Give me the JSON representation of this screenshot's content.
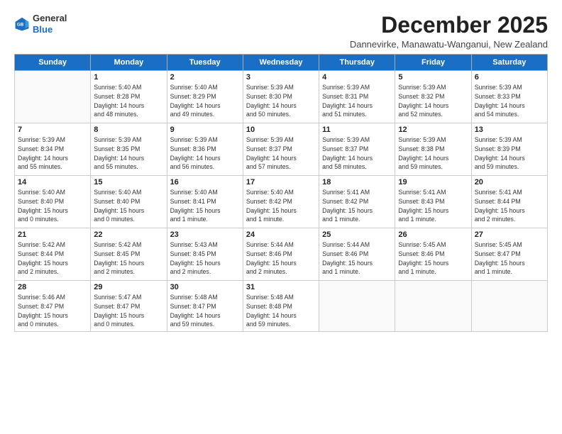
{
  "logo": {
    "line1": "General",
    "line2": "Blue"
  },
  "title": "December 2025",
  "location": "Dannevirke, Manawatu-Wanganui, New Zealand",
  "days_of_week": [
    "Sunday",
    "Monday",
    "Tuesday",
    "Wednesday",
    "Thursday",
    "Friday",
    "Saturday"
  ],
  "weeks": [
    [
      {
        "day": "",
        "info": ""
      },
      {
        "day": "1",
        "info": "Sunrise: 5:40 AM\nSunset: 8:28 PM\nDaylight: 14 hours\nand 48 minutes."
      },
      {
        "day": "2",
        "info": "Sunrise: 5:40 AM\nSunset: 8:29 PM\nDaylight: 14 hours\nand 49 minutes."
      },
      {
        "day": "3",
        "info": "Sunrise: 5:39 AM\nSunset: 8:30 PM\nDaylight: 14 hours\nand 50 minutes."
      },
      {
        "day": "4",
        "info": "Sunrise: 5:39 AM\nSunset: 8:31 PM\nDaylight: 14 hours\nand 51 minutes."
      },
      {
        "day": "5",
        "info": "Sunrise: 5:39 AM\nSunset: 8:32 PM\nDaylight: 14 hours\nand 52 minutes."
      },
      {
        "day": "6",
        "info": "Sunrise: 5:39 AM\nSunset: 8:33 PM\nDaylight: 14 hours\nand 54 minutes."
      }
    ],
    [
      {
        "day": "7",
        "info": "Sunrise: 5:39 AM\nSunset: 8:34 PM\nDaylight: 14 hours\nand 55 minutes."
      },
      {
        "day": "8",
        "info": "Sunrise: 5:39 AM\nSunset: 8:35 PM\nDaylight: 14 hours\nand 55 minutes."
      },
      {
        "day": "9",
        "info": "Sunrise: 5:39 AM\nSunset: 8:36 PM\nDaylight: 14 hours\nand 56 minutes."
      },
      {
        "day": "10",
        "info": "Sunrise: 5:39 AM\nSunset: 8:37 PM\nDaylight: 14 hours\nand 57 minutes."
      },
      {
        "day": "11",
        "info": "Sunrise: 5:39 AM\nSunset: 8:37 PM\nDaylight: 14 hours\nand 58 minutes."
      },
      {
        "day": "12",
        "info": "Sunrise: 5:39 AM\nSunset: 8:38 PM\nDaylight: 14 hours\nand 59 minutes."
      },
      {
        "day": "13",
        "info": "Sunrise: 5:39 AM\nSunset: 8:39 PM\nDaylight: 14 hours\nand 59 minutes."
      }
    ],
    [
      {
        "day": "14",
        "info": "Sunrise: 5:40 AM\nSunset: 8:40 PM\nDaylight: 15 hours\nand 0 minutes."
      },
      {
        "day": "15",
        "info": "Sunrise: 5:40 AM\nSunset: 8:40 PM\nDaylight: 15 hours\nand 0 minutes."
      },
      {
        "day": "16",
        "info": "Sunrise: 5:40 AM\nSunset: 8:41 PM\nDaylight: 15 hours\nand 1 minute."
      },
      {
        "day": "17",
        "info": "Sunrise: 5:40 AM\nSunset: 8:42 PM\nDaylight: 15 hours\nand 1 minute."
      },
      {
        "day": "18",
        "info": "Sunrise: 5:41 AM\nSunset: 8:42 PM\nDaylight: 15 hours\nand 1 minute."
      },
      {
        "day": "19",
        "info": "Sunrise: 5:41 AM\nSunset: 8:43 PM\nDaylight: 15 hours\nand 1 minute."
      },
      {
        "day": "20",
        "info": "Sunrise: 5:41 AM\nSunset: 8:44 PM\nDaylight: 15 hours\nand 2 minutes."
      }
    ],
    [
      {
        "day": "21",
        "info": "Sunrise: 5:42 AM\nSunset: 8:44 PM\nDaylight: 15 hours\nand 2 minutes."
      },
      {
        "day": "22",
        "info": "Sunrise: 5:42 AM\nSunset: 8:45 PM\nDaylight: 15 hours\nand 2 minutes."
      },
      {
        "day": "23",
        "info": "Sunrise: 5:43 AM\nSunset: 8:45 PM\nDaylight: 15 hours\nand 2 minutes."
      },
      {
        "day": "24",
        "info": "Sunrise: 5:44 AM\nSunset: 8:46 PM\nDaylight: 15 hours\nand 2 minutes."
      },
      {
        "day": "25",
        "info": "Sunrise: 5:44 AM\nSunset: 8:46 PM\nDaylight: 15 hours\nand 1 minute."
      },
      {
        "day": "26",
        "info": "Sunrise: 5:45 AM\nSunset: 8:46 PM\nDaylight: 15 hours\nand 1 minute."
      },
      {
        "day": "27",
        "info": "Sunrise: 5:45 AM\nSunset: 8:47 PM\nDaylight: 15 hours\nand 1 minute."
      }
    ],
    [
      {
        "day": "28",
        "info": "Sunrise: 5:46 AM\nSunset: 8:47 PM\nDaylight: 15 hours\nand 0 minutes."
      },
      {
        "day": "29",
        "info": "Sunrise: 5:47 AM\nSunset: 8:47 PM\nDaylight: 15 hours\nand 0 minutes."
      },
      {
        "day": "30",
        "info": "Sunrise: 5:48 AM\nSunset: 8:47 PM\nDaylight: 14 hours\nand 59 minutes."
      },
      {
        "day": "31",
        "info": "Sunrise: 5:48 AM\nSunset: 8:48 PM\nDaylight: 14 hours\nand 59 minutes."
      },
      {
        "day": "",
        "info": ""
      },
      {
        "day": "",
        "info": ""
      },
      {
        "day": "",
        "info": ""
      }
    ]
  ]
}
